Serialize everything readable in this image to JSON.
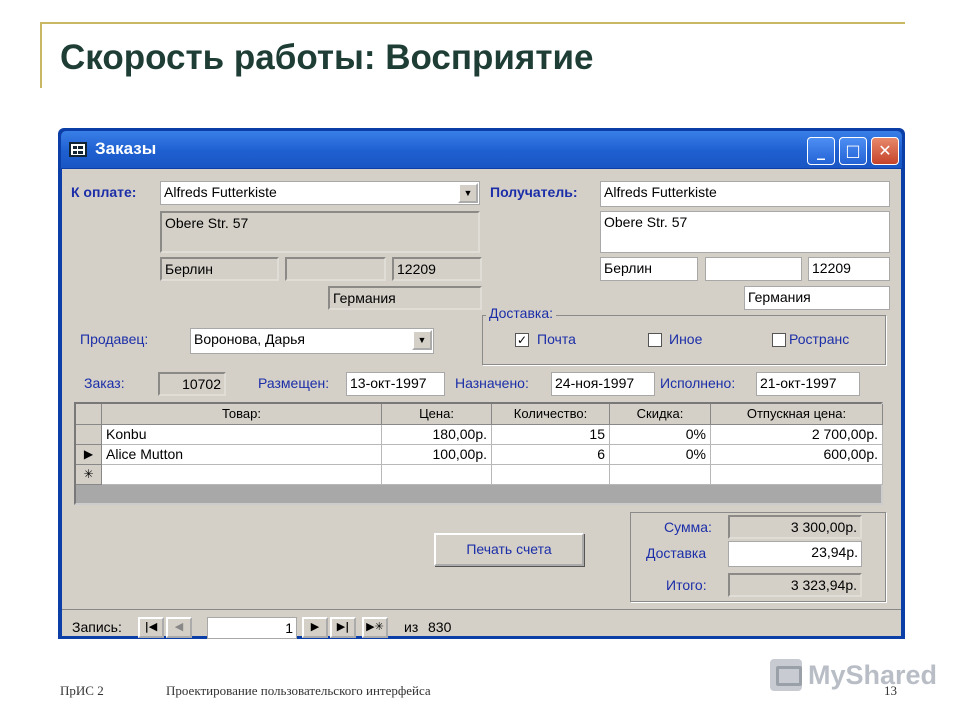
{
  "slide": {
    "title": "Скорость работы: Восприятие",
    "footer_left": "ПрИС 2",
    "footer_center": "Проектирование пользовательского интерфейса",
    "page_number": "13",
    "logo_text": "MyShared"
  },
  "window": {
    "title": "Заказы",
    "buttons": [
      "minimize",
      "maximize",
      "close"
    ]
  },
  "billing": {
    "label": "К оплате:",
    "customer": "Alfreds Futterkiste",
    "address": "Obere Str. 57",
    "city": "Берлин",
    "region": "",
    "postal": "12209",
    "country": "Германия"
  },
  "recipient": {
    "label": "Получатель:",
    "name": "Alfreds Futterkiste",
    "address": "Obere Str. 57",
    "city": "Берлин",
    "region": "",
    "postal": "12209",
    "country": "Германия"
  },
  "seller": {
    "label": "Продавец:",
    "value": "Воронова, Дарья"
  },
  "shipping": {
    "label": "Доставка:",
    "options": [
      {
        "label": "Почта",
        "checked": true
      },
      {
        "label": "Иное",
        "checked": false
      },
      {
        "label": "Ространс",
        "checked": false
      }
    ]
  },
  "order": {
    "order_label": "Заказ:",
    "order_id": "10702",
    "placed_label": "Размещен:",
    "placed": "13-окт-1997",
    "due_label": "Назначено:",
    "due": "24-ноя-1997",
    "done_label": "Исполнено:",
    "done": "21-окт-1997"
  },
  "grid": {
    "columns": [
      "Товар:",
      "Цена:",
      "Количество:",
      "Скидка:",
      "Отпускная цена:"
    ],
    "rows": [
      {
        "selector": "",
        "product": "Konbu",
        "price": "180,00р.",
        "qty": "15",
        "discount": "0%",
        "total": "2 700,00р."
      },
      {
        "selector": "▶",
        "product": "Alice Mutton",
        "price": "100,00р.",
        "qty": "6",
        "discount": "0%",
        "total": "600,00р."
      }
    ],
    "new_row_marker": "✳"
  },
  "print_button": "Печать счета",
  "totals": {
    "sum_label": "Сумма:",
    "sum": "3 300,00р.",
    "shipping_label": "Доставка",
    "shipping": "23,94р.",
    "total_label": "Итого:",
    "total": "3 323,94р."
  },
  "navigator": {
    "label": "Запись:",
    "current": "1",
    "of_label": "из",
    "count": "830"
  },
  "colors": {
    "title_text": "#1d3d35",
    "accent_line": "#c8b864",
    "window_frame": "#0b3ea6",
    "form_bg": "#d4d0c8",
    "label_text": "#1b2ea8"
  }
}
